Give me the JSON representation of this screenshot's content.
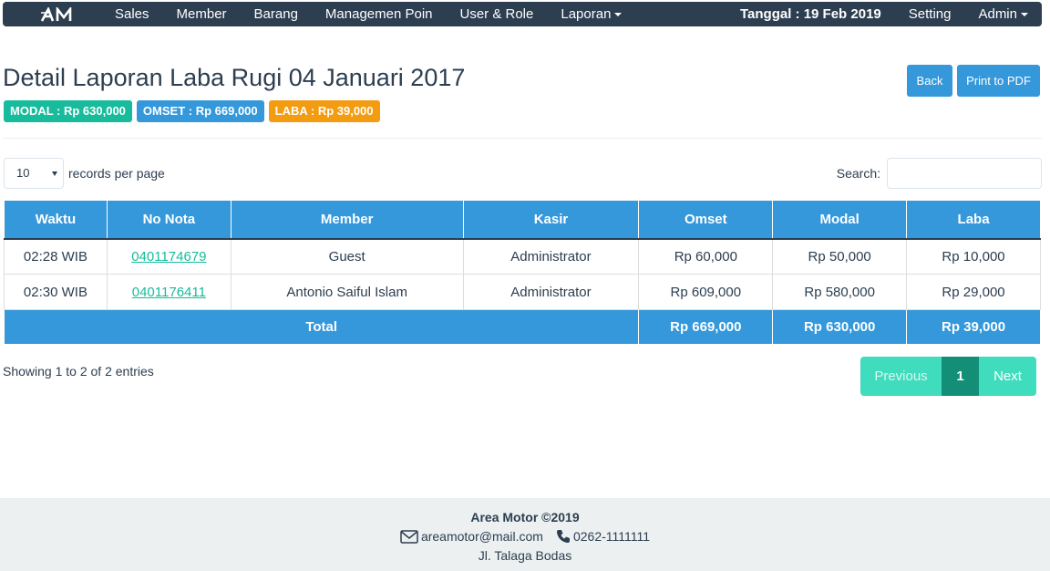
{
  "nav": {
    "brand": "AM",
    "items": [
      "Sales",
      "Member",
      "Barang",
      "Managemen Poin",
      "User & Role",
      "Laporan"
    ],
    "date": "Tanggal : 19 Feb 2019",
    "setting": "Setting",
    "admin": "Admin"
  },
  "header": {
    "title": "Detail Laporan Laba Rugi 04 Januari 2017",
    "back": "Back",
    "pdf": "Print to PDF"
  },
  "badges": {
    "modal": "MODAL : Rp 630,000",
    "omset": "OMSET : Rp 669,000",
    "laba": "LABA : Rp 39,000"
  },
  "controls": {
    "length_value": "10",
    "length_label": "records per page",
    "search_label": "Search:",
    "search_value": ""
  },
  "table": {
    "columns": [
      "Waktu",
      "No Nota",
      "Member",
      "Kasir",
      "Omset",
      "Modal",
      "Laba"
    ],
    "rows": [
      {
        "waktu": "02:28 WIB",
        "nota": "0401174679",
        "member": "Guest",
        "kasir": "Administrator",
        "omset": "Rp 60,000",
        "modal": "Rp 50,000",
        "laba": "Rp 10,000"
      },
      {
        "waktu": "02:30 WIB",
        "nota": "0401176411",
        "member": "Antonio Saiful Islam",
        "kasir": "Administrator",
        "omset": "Rp 609,000",
        "modal": "Rp 580,000",
        "laba": "Rp 29,000"
      }
    ],
    "total": {
      "label": "Total",
      "omset": "Rp 669,000",
      "modal": "Rp 630,000",
      "laba": "Rp 39,000"
    }
  },
  "info": "Showing 1 to 2 of 2 entries",
  "pager": {
    "previous": "Previous",
    "current": "1",
    "next": "Next"
  },
  "footer": {
    "title": "Area Motor ©2019",
    "email": "areamotor@mail.com",
    "phone": "0262-1111111",
    "address": "Jl. Talaga Bodas"
  },
  "colors": {
    "primary": "#3498db",
    "success": "#18bc9c",
    "warning": "#f39c12",
    "navbar": "#2c3e50"
  }
}
